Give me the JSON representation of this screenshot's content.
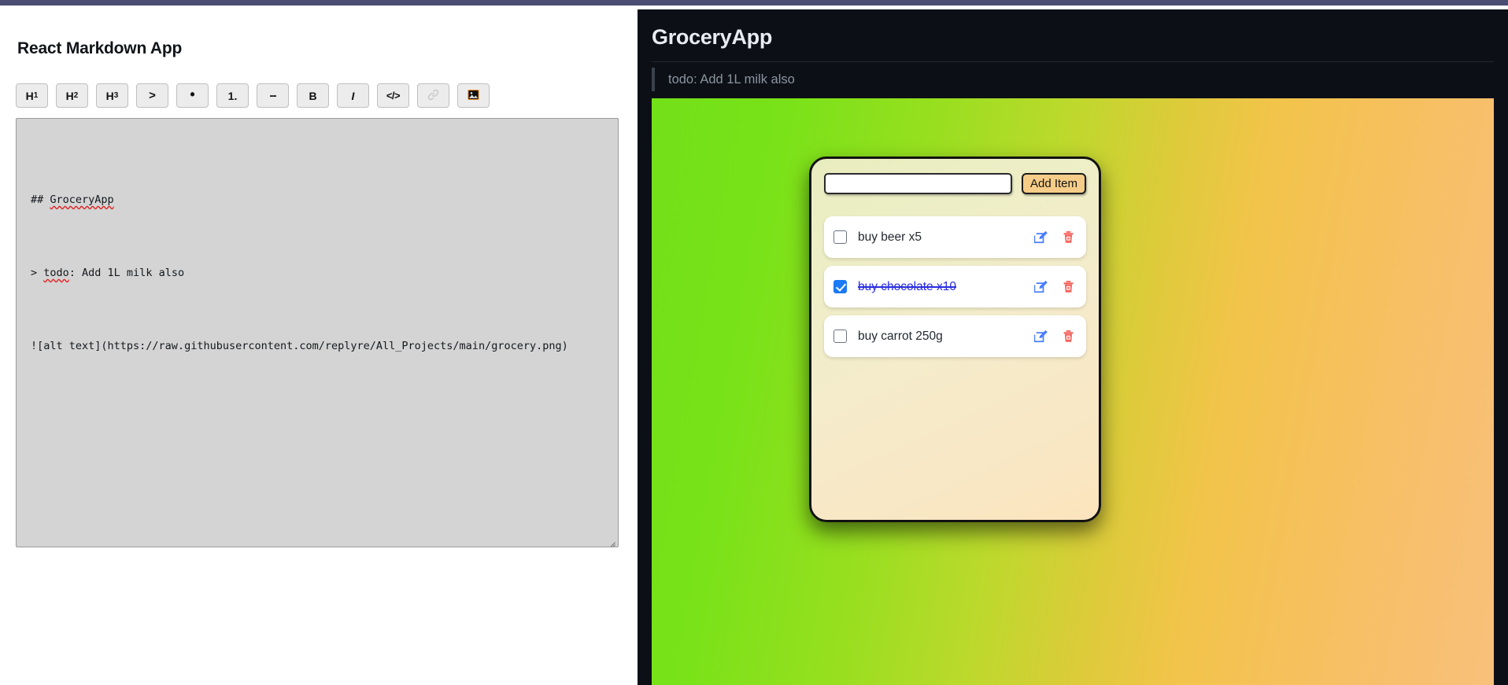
{
  "window": {
    "accent_bar_color": "#4b4e72"
  },
  "editor": {
    "app_title": "React Markdown App",
    "toolbar": [
      {
        "name": "heading-1",
        "label": "H",
        "sub": "1"
      },
      {
        "name": "heading-2",
        "label": "H",
        "sub": "2"
      },
      {
        "name": "heading-3",
        "label": "H",
        "sub": "3"
      },
      {
        "name": "blockquote",
        "label": ">",
        "sub": ""
      },
      {
        "name": "bullet-list",
        "label": "•",
        "sub": ""
      },
      {
        "name": "numbered-list",
        "label": "1.",
        "sub": ""
      },
      {
        "name": "horizontal-rule",
        "label": "--",
        "sub": ""
      },
      {
        "name": "bold",
        "label": "B",
        "sub": ""
      },
      {
        "name": "italic",
        "label": "I",
        "sub": ""
      },
      {
        "name": "code",
        "label": "</>",
        "sub": ""
      },
      {
        "name": "link",
        "label": "",
        "sub": ""
      },
      {
        "name": "image",
        "label": "",
        "sub": ""
      }
    ],
    "markdown_lines": [
      "## GroceryApp",
      "> todo: Add 1L milk also",
      "![alt text](https://raw.githubusercontent.com/replyre/All_Projects/main/grocery.png)"
    ],
    "markdown_source": "## GroceryApp\n\n> todo: Add 1L milk also\n\n![alt text](https://raw.githubusercontent.com/replyre/All_Projects/main/grocery.png)",
    "spellcheck_words": [
      "GroceryApp",
      "todo"
    ],
    "textarea_bg": "#d4d4d4"
  },
  "preview": {
    "background": "#0c0f16",
    "heading": "GroceryApp",
    "blockquote": "todo: Add 1L milk also",
    "image_alt": "alt text",
    "gradient_from": "#72e019",
    "gradient_to": "#f8c07a"
  },
  "grocery_app": {
    "input_value": "",
    "input_placeholder": "",
    "add_button_label": "Add Item",
    "add_button_color": "#f6cd88",
    "items": [
      {
        "label": "buy beer x5",
        "checked": false
      },
      {
        "label": "buy chocolate x10",
        "checked": true
      },
      {
        "label": "buy carrot 250g",
        "checked": false
      }
    ],
    "edit_icon_color": "#4a7dfc",
    "delete_icon_color": "#f4635c",
    "checked_accent": "#1b7af5"
  }
}
